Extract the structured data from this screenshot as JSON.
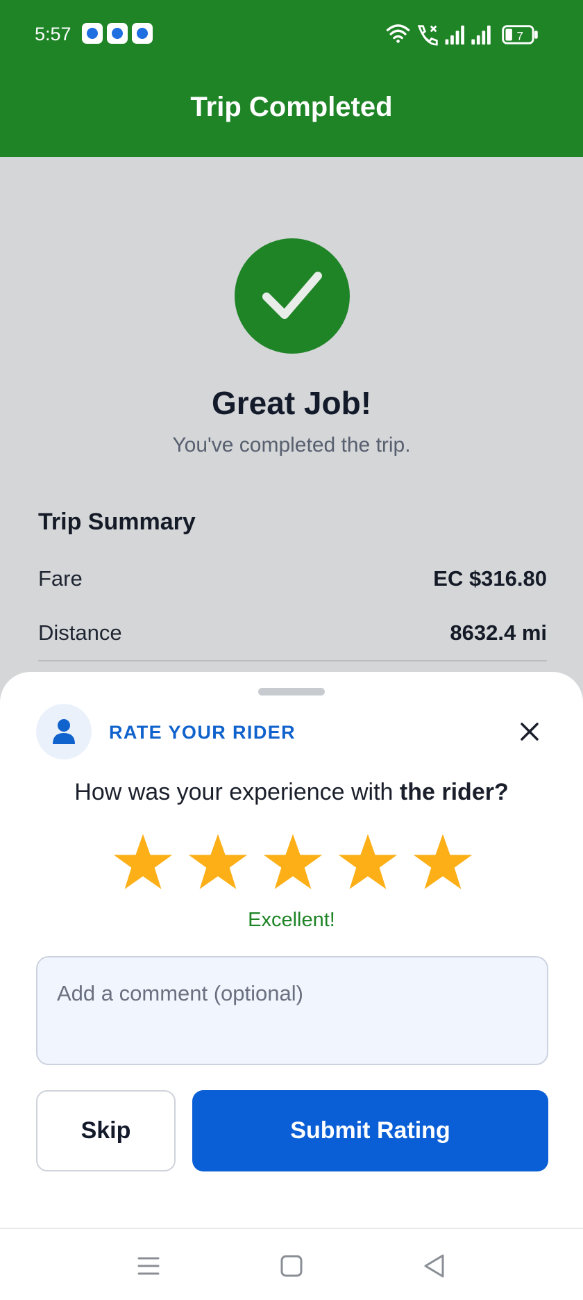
{
  "status_bar": {
    "time": "5:57",
    "notification_icons": [
      "messenger-icon",
      "messenger-icon",
      "app-notification-icon"
    ],
    "battery_level": "7",
    "system_icons": [
      "wifi-icon",
      "call-icon",
      "signal-icon",
      "signal-icon",
      "battery-icon"
    ]
  },
  "header": {
    "title": "Trip Completed",
    "color": "#1e8426"
  },
  "completion": {
    "icon": "checkmark-icon",
    "title": "Great Job!",
    "subtitle": "You've completed the trip."
  },
  "summary": {
    "title": "Trip Summary",
    "rows": [
      {
        "label": "Fare",
        "value": "EC $316.80"
      },
      {
        "label": "Distance",
        "value": "8632.4 mi"
      }
    ]
  },
  "rating_sheet": {
    "header_label": "RATE YOUR RIDER",
    "avatar_icon": "person-icon",
    "close_icon": "close-icon",
    "question_prefix": "How was your experience with ",
    "question_bold": "the rider?",
    "stars_selected": 5,
    "stars_total": 5,
    "star_color": "#fcaf17",
    "rating_text": "Excellent!",
    "comment": {
      "value": "",
      "placeholder": "Add a comment (optional)"
    },
    "skip_label": "Skip",
    "submit_label": "Submit Rating",
    "accent_color": "#0a5ed6"
  },
  "nav_bar": {
    "icons": [
      "menu-icon",
      "home-icon",
      "back-icon"
    ]
  }
}
